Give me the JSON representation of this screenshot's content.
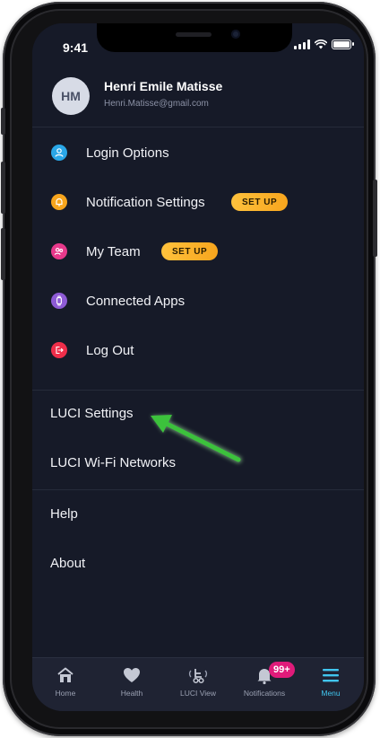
{
  "status_bar": {
    "time": "9:41"
  },
  "profile": {
    "initials": "HM",
    "name": "Henri Emile Matisse",
    "email": "Henri.Matisse@gmail.com"
  },
  "menu": {
    "items": [
      {
        "label": "Login Options",
        "icon": "user-icon",
        "icon_color": "#2aa7e8"
      },
      {
        "label": "Notification Settings",
        "icon": "bell-icon",
        "icon_color": "#f7a51d",
        "badge": "SET UP"
      },
      {
        "label": "My Team",
        "icon": "team-icon",
        "icon_color": "#e8398b",
        "badge": "SET UP"
      },
      {
        "label": "Connected Apps",
        "icon": "watch-icon",
        "icon_color": "#8e5bd6"
      },
      {
        "label": "Log Out",
        "icon": "logout-icon",
        "icon_color": "#ef2e4a"
      }
    ],
    "luci_settings": "LUCI Settings",
    "luci_wifi": "LUCI Wi-Fi Networks",
    "help": "Help",
    "about": "About"
  },
  "tabbar": {
    "tabs": [
      {
        "label": "Home",
        "icon": "home-icon"
      },
      {
        "label": "Health",
        "icon": "heart-icon"
      },
      {
        "label": "LUCI View",
        "icon": "wheelchair-icon"
      },
      {
        "label": "Notifications",
        "icon": "bell-icon",
        "badge": "99+"
      },
      {
        "label": "Menu",
        "icon": "hamburger-menu-icon",
        "active": true
      }
    ]
  },
  "colors": {
    "background": "#161a28",
    "accent": "#41c6ef",
    "badge": "#f7a51d",
    "notification_badge": "#e01b7a",
    "arrow": "#3cc23c"
  }
}
